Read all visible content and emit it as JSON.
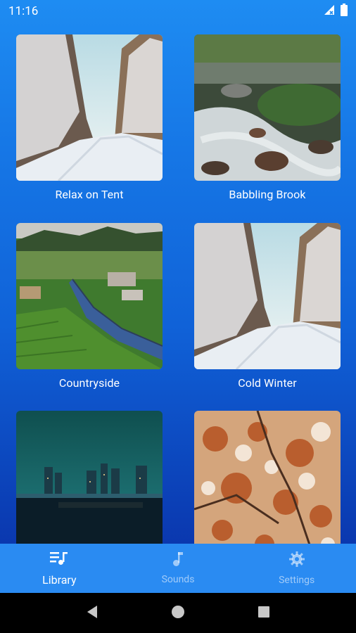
{
  "status_bar": {
    "time": "11:16"
  },
  "library": {
    "items": [
      {
        "label": "Relax on Tent"
      },
      {
        "label": "Babbling Brook"
      },
      {
        "label": "Countryside"
      },
      {
        "label": "Cold Winter"
      },
      {
        "label": ""
      },
      {
        "label": ""
      }
    ]
  },
  "bottom_nav": {
    "items": [
      {
        "label": "Library",
        "icon": "playlist-icon",
        "active": true
      },
      {
        "label": "Sounds",
        "icon": "music-note-icon",
        "active": false
      },
      {
        "label": "Settings",
        "icon": "gear-icon",
        "active": false
      }
    ]
  },
  "colors": {
    "gradient_top": "#1e8cf2",
    "gradient_bottom": "#0a2fa6",
    "nav_bar": "#2a8bf2"
  }
}
